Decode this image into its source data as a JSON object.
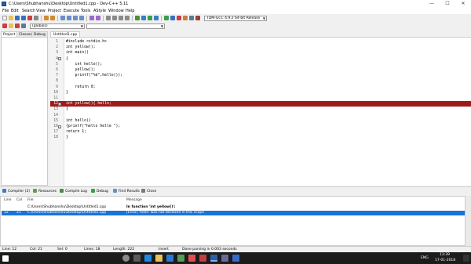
{
  "window": {
    "title": "C:\\Users\\Shubhanshu\\Desktop\\Untitled1.cpp - Dev-C++ 5.11",
    "minimize": "—",
    "maximize": "☐",
    "close": "✕"
  },
  "menu": [
    "File",
    "Edit",
    "Search",
    "View",
    "Project",
    "Execute",
    "Tools",
    "AStyle",
    "Window",
    "Help"
  ],
  "toolbar": {
    "compiler_select": "TDM-GCC 4.9.2 64-bit Release",
    "scope_select": "(globals)"
  },
  "left_tabs": [
    "Project",
    "Classes",
    "Debug"
  ],
  "file_tab": "Untitled1.cpp",
  "code_lines": [
    {
      "n": "1",
      "fold": "",
      "text": "#include <stdio.h>"
    },
    {
      "n": "2",
      "fold": "",
      "text": "int yellow();"
    },
    {
      "n": "3",
      "fold": "",
      "text": "int main()"
    },
    {
      "n": "4",
      "fold": "−",
      "text": "{"
    },
    {
      "n": "5",
      "fold": "",
      "text": "    int hello();"
    },
    {
      "n": "6",
      "fold": "",
      "text": "    yellow();"
    },
    {
      "n": "7",
      "fold": "",
      "text": "    printf(\"%d\",hello());"
    },
    {
      "n": "8",
      "fold": "",
      "text": ""
    },
    {
      "n": "9",
      "fold": "",
      "text": "    return 0;"
    },
    {
      "n": "10",
      "fold": "",
      "text": "}"
    },
    {
      "n": "11",
      "fold": "",
      "text": ""
    },
    {
      "n": "12",
      "fold": "−",
      "text": "int yellow(){ hello;"
    },
    {
      "n": "13",
      "fold": "",
      "text": "}"
    },
    {
      "n": "14",
      "fold": "",
      "text": ""
    },
    {
      "n": "15",
      "fold": "",
      "text": "int hello()"
    },
    {
      "n": "16",
      "fold": "−",
      "text": "{printf(\"hello helle \");"
    },
    {
      "n": "17",
      "fold": "",
      "text": "return 1;"
    },
    {
      "n": "18",
      "fold": "",
      "text": "}"
    }
  ],
  "bottom_tabs": [
    "Compiler (2)",
    "Resources",
    "Compile Log",
    "Debug",
    "Find Results",
    "Close"
  ],
  "messages": {
    "headers": [
      "Line",
      "Col",
      "File",
      "Message"
    ],
    "rows": [
      {
        "line": "",
        "col": "",
        "file": "C:\\Users\\Shubhanshu\\Desktop\\Untitled1.cpp",
        "message": "In function 'int yellow()':"
      },
      {
        "line": "12",
        "col": "21",
        "file": "C:\\Users\\Shubhanshu\\Desktop\\Untitled1.cpp",
        "message": "[Error] 'hello' was not declared in this scope"
      }
    ]
  },
  "status": {
    "line": "Line:    12",
    "col": "Col:    21",
    "sel": "Sel:    0",
    "lines": "Lines:    18",
    "length": "Length:    222",
    "mode": "Insert",
    "parse": "Done parsing in 0.003 seconds"
  },
  "taskbar": {
    "time": "13:39",
    "date": "17-01-2018",
    "lang": "ENG"
  }
}
